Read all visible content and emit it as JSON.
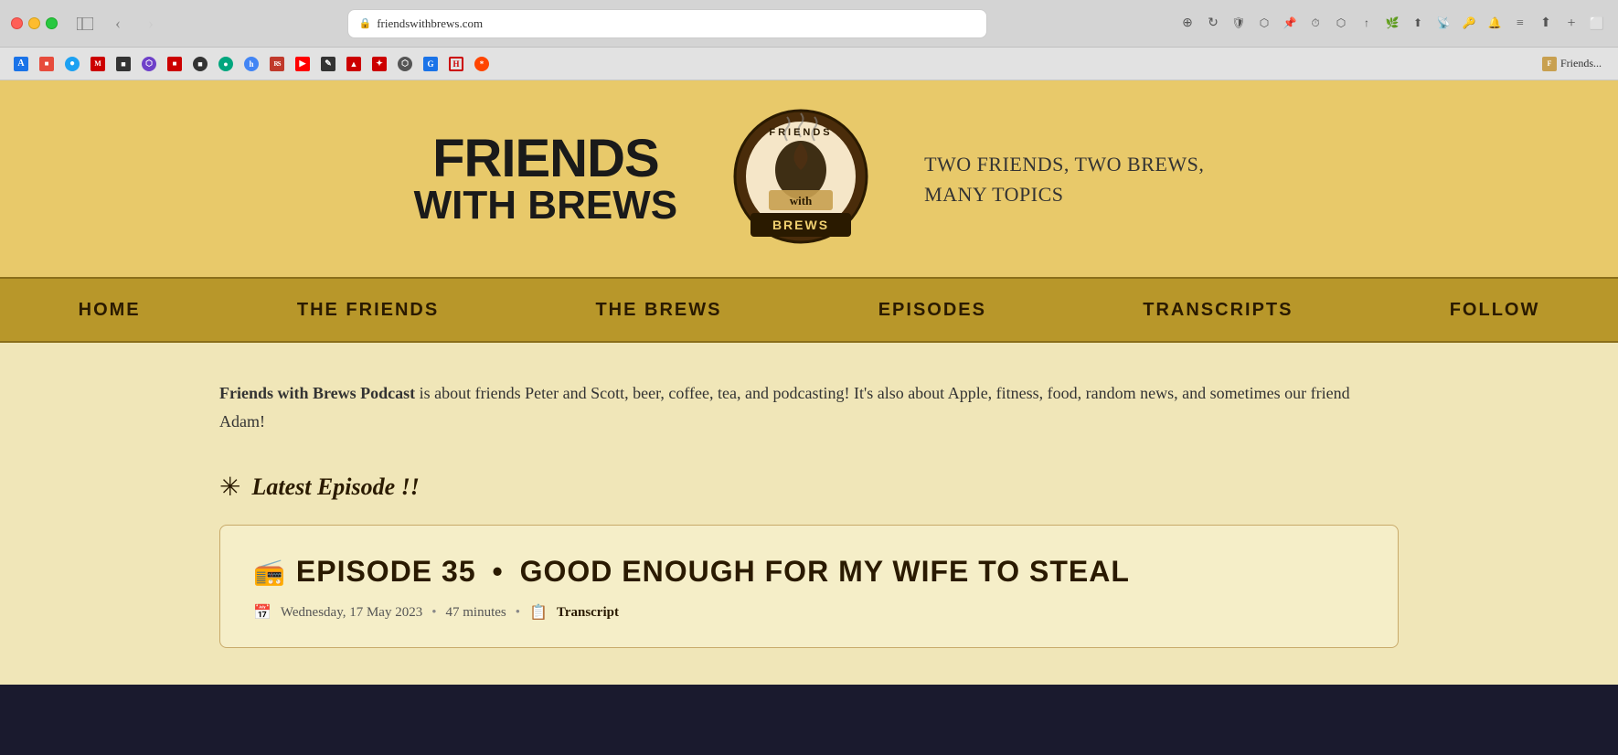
{
  "browser": {
    "url": "friendswithbrews.com",
    "tab_title": "Friends...",
    "controls": {
      "back": "‹",
      "forward": "›"
    }
  },
  "bookmarks": [
    {
      "color": "#1a73e8",
      "letter": "A"
    },
    {
      "color": "#555",
      "letter": "■"
    },
    {
      "color": "#1da1f2",
      "letter": "●"
    },
    {
      "color": "#c00",
      "letter": "M"
    },
    {
      "color": "#333",
      "letter": "■"
    },
    {
      "color": "#333",
      "letter": "⬡"
    },
    {
      "color": "#c00",
      "letter": "■"
    },
    {
      "color": "#6e40c9",
      "letter": "●"
    },
    {
      "color": "#1da1f2",
      "letter": "✦"
    },
    {
      "color": "#00a67e",
      "letter": "●"
    },
    {
      "color": "#4285f4",
      "letter": "h"
    },
    {
      "color": "#c00",
      "letter": "RS"
    },
    {
      "color": "#ff0000",
      "letter": "▶"
    },
    {
      "color": "#333",
      "letter": "✎"
    },
    {
      "color": "#333",
      "letter": "▲"
    },
    {
      "color": "#c00",
      "letter": "✦"
    },
    {
      "color": "#333",
      "letter": "⬡"
    },
    {
      "color": "#1a73e8",
      "letter": "G"
    },
    {
      "color": "#6e40c9",
      "letter": "H"
    },
    {
      "color": "#ff4500",
      "letter": "*"
    }
  ],
  "site": {
    "title_line1": "FRIENDS",
    "title_line2": "WITH BREWS",
    "tagline_line1": "TWO FRIENDS, TWO BREWS,",
    "tagline_line2": "MANY TOPICS",
    "nav": {
      "items": [
        "HOME",
        "THE FRIENDS",
        "THE BREWS",
        "EPISODES",
        "TRANSCRIPTS",
        "FOLLOW"
      ]
    },
    "intro": {
      "bold_text": "Friends with Brews Podcast",
      "rest_text": " is about friends Peter and Scott, beer, coffee, tea, and podcasting! It's also about Apple, fitness, food, random news, and sometimes our friend Adam!"
    },
    "latest_section": {
      "icon": "✳",
      "label": "Latest Episode !!"
    },
    "episode": {
      "number": "EPISODE 35",
      "separator": "•",
      "title": "GOOD ENOUGH FOR MY WIFE TO STEAL",
      "date_icon": "📅",
      "date": "Wednesday, 17 May 2023",
      "duration_icon": "⏱",
      "duration": "47 minutes",
      "transcript_icon": "📋",
      "transcript_label": "Transcript"
    }
  }
}
